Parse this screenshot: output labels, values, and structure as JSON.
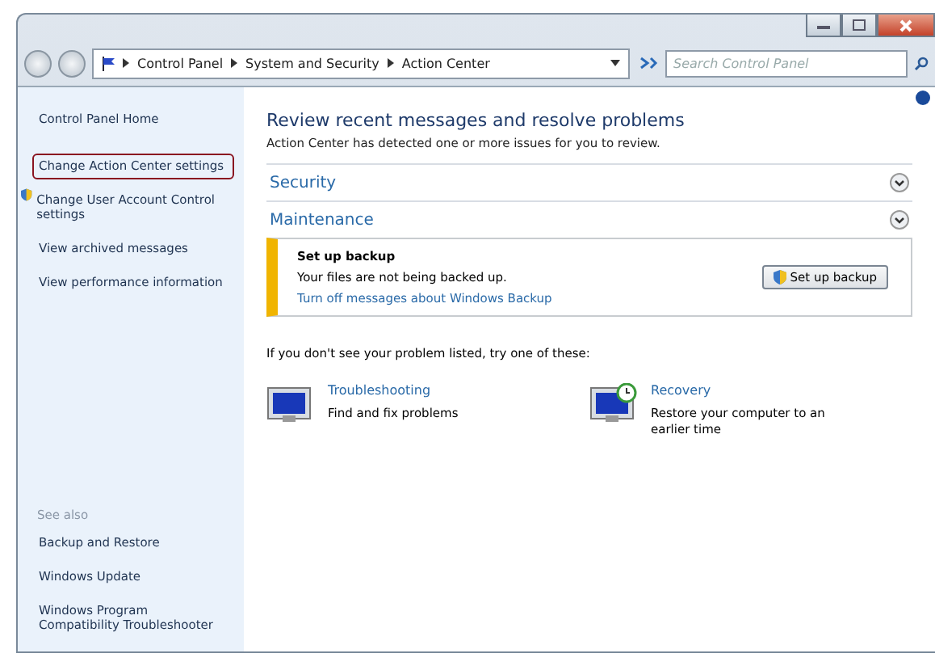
{
  "address_bar": {
    "crumbs": [
      "Control Panel",
      "System and Security",
      "Action Center"
    ],
    "search_placeholder": "Search Control Panel"
  },
  "sidebar": {
    "items": [
      {
        "label": "Control Panel Home",
        "kind": "home",
        "highlighted": false
      },
      {
        "label": "Change Action Center settings",
        "kind": "link",
        "highlighted": true
      },
      {
        "label": "Change User Account Control settings",
        "kind": "shield",
        "highlighted": false
      },
      {
        "label": "View archived messages",
        "kind": "link",
        "highlighted": false
      },
      {
        "label": "View performance information",
        "kind": "link",
        "highlighted": false
      }
    ],
    "see_also_title": "See also",
    "see_also": [
      "Backup and Restore",
      "Windows Update",
      "Windows Program Compatibility Troubleshooter"
    ]
  },
  "main": {
    "title": "Review recent messages and resolve problems",
    "subtitle": "Action Center has detected one or more issues for you to review.",
    "sections": [
      {
        "label": "Security"
      },
      {
        "label": "Maintenance"
      }
    ],
    "alert": {
      "title": "Set up backup",
      "message": "Your files are not being backed up.",
      "link": "Turn off messages about Windows Backup",
      "button": "Set up backup"
    },
    "prompt": "If you don't see your problem listed, try one of these:",
    "tools": [
      {
        "kind": "troubleshooting",
        "title": "Troubleshooting",
        "description": "Find and fix problems"
      },
      {
        "kind": "recovery",
        "title": "Recovery",
        "description": "Restore your computer to an earlier time"
      }
    ]
  }
}
